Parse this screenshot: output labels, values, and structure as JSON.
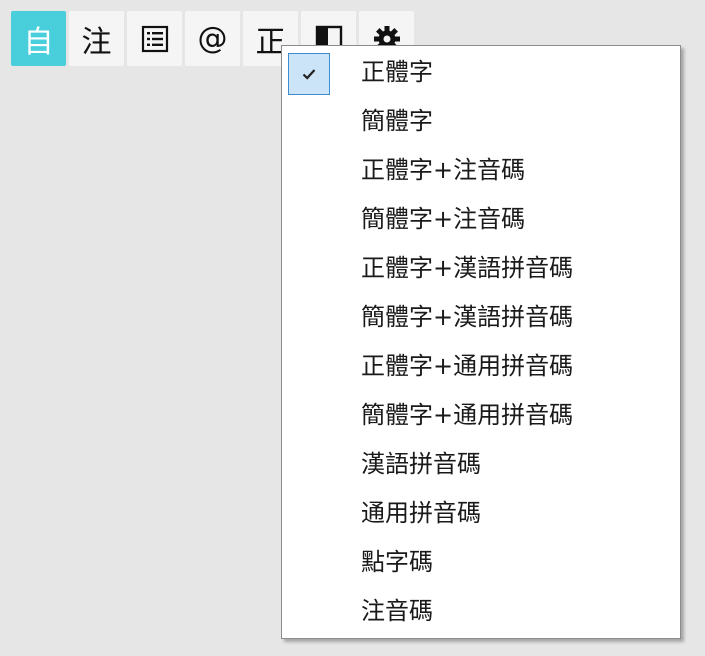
{
  "toolbar": {
    "buttons": [
      {
        "label": "自",
        "icon": null,
        "active": true
      },
      {
        "label": "注",
        "icon": null,
        "active": false
      },
      {
        "label": "",
        "icon": "list-icon",
        "active": false
      },
      {
        "label": "@",
        "icon": null,
        "active": false
      },
      {
        "label": "正",
        "icon": null,
        "active": false
      },
      {
        "label": "",
        "icon": "panel-icon",
        "active": false
      },
      {
        "label": "",
        "icon": "gear-icon",
        "active": false
      }
    ]
  },
  "menu": {
    "items": [
      {
        "label": "正體字",
        "checked": true
      },
      {
        "label": "簡體字",
        "checked": false
      },
      {
        "label": "正體字+注音碼",
        "checked": false
      },
      {
        "label": "簡體字+注音碼",
        "checked": false
      },
      {
        "label": "正體字+漢語拼音碼",
        "checked": false
      },
      {
        "label": "簡體字+漢語拼音碼",
        "checked": false
      },
      {
        "label": "正體字+通用拼音碼",
        "checked": false
      },
      {
        "label": "簡體字+通用拼音碼",
        "checked": false
      },
      {
        "label": "漢語拼音碼",
        "checked": false
      },
      {
        "label": "通用拼音碼",
        "checked": false
      },
      {
        "label": "點字碼",
        "checked": false
      },
      {
        "label": "注音碼",
        "checked": false
      }
    ]
  },
  "colors": {
    "active_button": "#49cfdb",
    "check_highlight": "#cce4f7",
    "check_border": "#3c8cd2"
  }
}
